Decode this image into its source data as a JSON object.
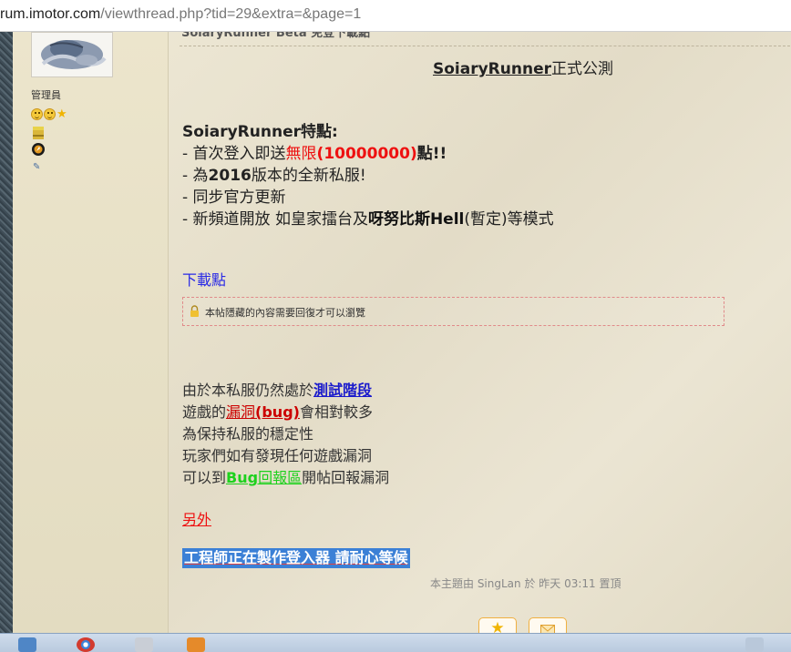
{
  "browser": {
    "url_prefix": "rum.imotor.com",
    "url_rest": "/viewthread.php?tid=29&extra=&page=1"
  },
  "user": {
    "role": "管理員"
  },
  "post": {
    "cutoff_heading": "SoiaryRunner Beta 免登下載點",
    "title_name": "SoiaryRunner",
    "title_suffix": "正式公測",
    "features_heading": "SoiaryRunner特點:",
    "feature1_pre": "- 首次登入即送",
    "feature1_red1": "無限",
    "feature1_red2": "(10000000)",
    "feature1_post": "點!!",
    "feature2_pre": "- 為",
    "feature2_bold": "2016",
    "feature2_post": "版本的全新私服!",
    "feature3": "- 同步官方更新",
    "feature4_pre": "- 新頻道開放 如皇家擂台及",
    "feature4_bold1": "呀努比斯",
    "feature4_bold2": "Hell",
    "feature4_post": "(暫定)等模式",
    "download_label": "下載點",
    "locked_notice": "本帖隱藏的內容需要回復才可以瀏覽",
    "p1_pre": "由於本私服仍然處於",
    "p1_link": "測試階段",
    "p2_pre": "遊戲的",
    "p2_link_a": "漏洞",
    "p2_link_b": "(bug)",
    "p2_post": "會相對較多",
    "p3": "為保持私服的穩定性",
    "p4": "玩家們如有發現任何遊戲漏洞",
    "p5_pre": "可以到",
    "p5_link_a": "Bug",
    "p5_link_b": "回報區",
    "p5_post": "開帖回報漏洞",
    "other": "另外",
    "highlight": "工程師正在製作登入器 請耐心等候",
    "pinned_note": "本主題由 SingLan 於 昨天 03:11 置頂"
  },
  "colors": {
    "accent_red": "#ee1111",
    "link_blue": "#1a1acc",
    "link_green": "#1dd11d",
    "highlight_bg": "#3b80d6"
  },
  "icons": {
    "lock": "lock-icon",
    "favorite": "star-icon",
    "share": "envelope-icon"
  }
}
